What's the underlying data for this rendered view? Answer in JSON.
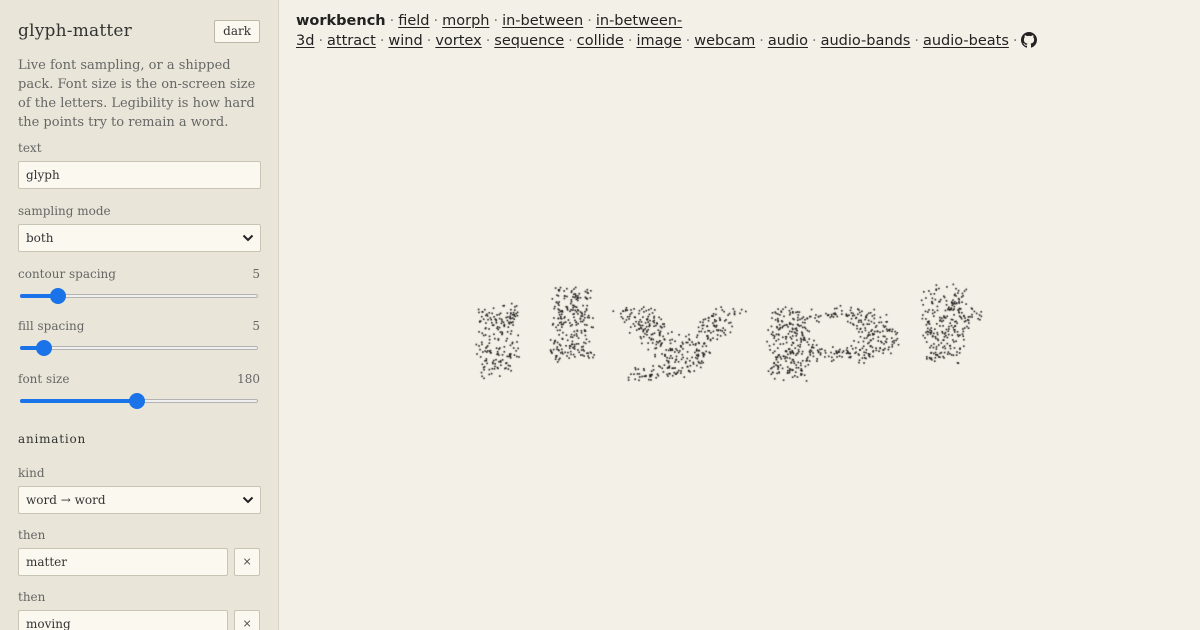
{
  "sidebar": {
    "title": "glyph-matter",
    "theme_button": "dark",
    "description": "Live font sampling, or a shipped pack. Font size is the on-screen size of the letters. Legibility is how hard the points try to remain a word.",
    "text_label": "text",
    "text_value": "glyph",
    "sampling_label": "sampling mode",
    "sampling_value": "both",
    "contour_label": "contour spacing",
    "contour_value": "5",
    "contour_fraction": 0.16,
    "fill_label": "fill spacing",
    "fill_value": "5",
    "fill_fraction": 0.1,
    "font_label": "font size",
    "font_value": "180",
    "font_fraction": 0.49,
    "animation_heading": "animation",
    "kind_label": "kind",
    "kind_value": "word → word",
    "then1_label": "then",
    "then1_value": "matter",
    "then2_label": "then",
    "then2_value": "moving",
    "remove_glyph": "×"
  },
  "nav": {
    "current": "workbench",
    "separator": "·",
    "links": [
      "field",
      "morph",
      "in-between",
      "in-between-3d",
      "attract",
      "wind",
      "vortex",
      "sequence",
      "collide",
      "image",
      "webcam",
      "audio",
      "audio-bands",
      "audio-beats"
    ],
    "github_icon": "github-icon"
  },
  "canvas": {
    "word": "glyph",
    "dot_color": "#1e1e1e"
  }
}
